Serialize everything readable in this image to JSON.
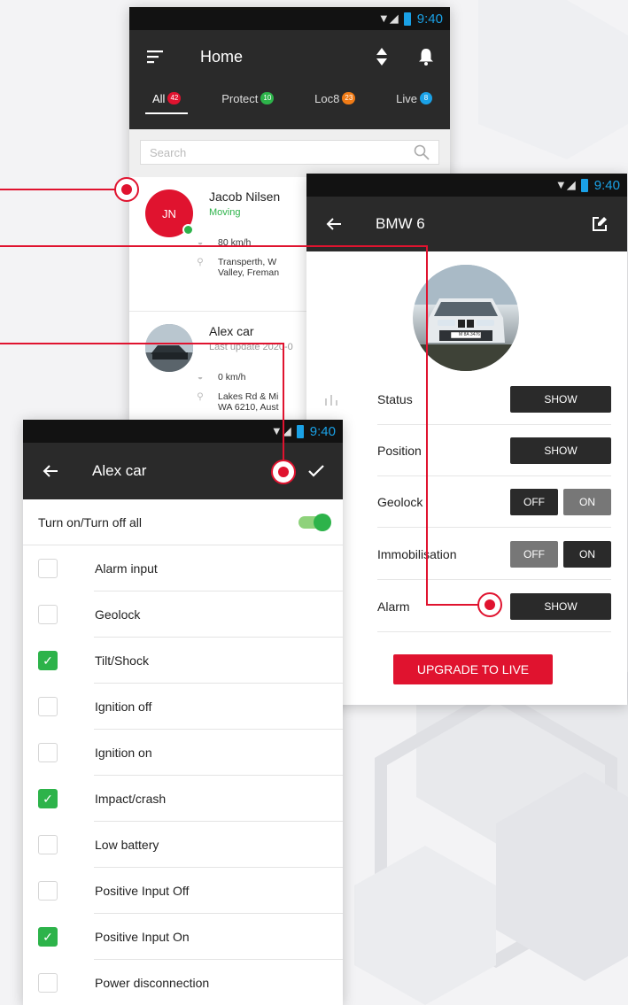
{
  "colors": {
    "accent_red": "#e0132f",
    "green": "#2db34a",
    "blue": "#1aa1e6",
    "appbar": "#2a2a2a"
  },
  "status_bar": {
    "time": "9:40"
  },
  "home": {
    "title": "Home",
    "icons": {
      "menu": "sort-icon",
      "sort": "sort-updown-icon",
      "notifications": "bell-icon"
    },
    "tabs": [
      {
        "label": "All",
        "count": "42",
        "badge_color": "#e0132f"
      },
      {
        "label": "Protect",
        "count": "10",
        "badge_color": "#2db34a"
      },
      {
        "label": "Loc8",
        "count": "23",
        "badge_color": "#f07b16"
      },
      {
        "label": "Live",
        "count": "8",
        "badge_color": "#1aa1e6"
      }
    ],
    "search": {
      "placeholder": "Search"
    },
    "vehicles": [
      {
        "initials": "JN",
        "name": "Jacob Nilsen",
        "status": "Moving",
        "speed": "80 km/h",
        "address_1": "Transperth, W",
        "address_2": "Valley, Freman"
      },
      {
        "name": "Alex car",
        "status": "Last update 2020-0",
        "speed": "0 km/h",
        "address_1": "Lakes Rd & Mi",
        "address_2": "WA 6210, Aust"
      }
    ]
  },
  "bmw": {
    "title": "BMW 6",
    "plate": "M 8A 3476",
    "settings": [
      {
        "label": "Status",
        "type": "show",
        "button": "SHOW"
      },
      {
        "label": "Position",
        "type": "show",
        "button": "SHOW"
      },
      {
        "label": "Geolock",
        "type": "toggle",
        "off": "OFF",
        "on": "ON",
        "value": "OFF"
      },
      {
        "label": "Immobilisation",
        "type": "toggle",
        "off": "OFF",
        "on": "ON",
        "value": "ON"
      },
      {
        "label": "Alarm",
        "type": "show",
        "button": "SHOW"
      }
    ],
    "upgrade_label": "UPGRADE TO LIVE"
  },
  "alex": {
    "title": "Alex car",
    "all_label": "Turn on/Turn off all",
    "all_on": true,
    "alarms": [
      {
        "label": "Alarm input",
        "checked": false
      },
      {
        "label": "Geolock",
        "checked": false
      },
      {
        "label": "Tilt/Shock",
        "checked": true
      },
      {
        "label": "Ignition off",
        "checked": false
      },
      {
        "label": "Ignition on",
        "checked": false
      },
      {
        "label": "Impact/crash",
        "checked": true
      },
      {
        "label": "Low battery",
        "checked": false
      },
      {
        "label": "Positive Input Off",
        "checked": false
      },
      {
        "label": "Positive Input On",
        "checked": true
      },
      {
        "label": "Power disconnection",
        "checked": false
      }
    ]
  }
}
